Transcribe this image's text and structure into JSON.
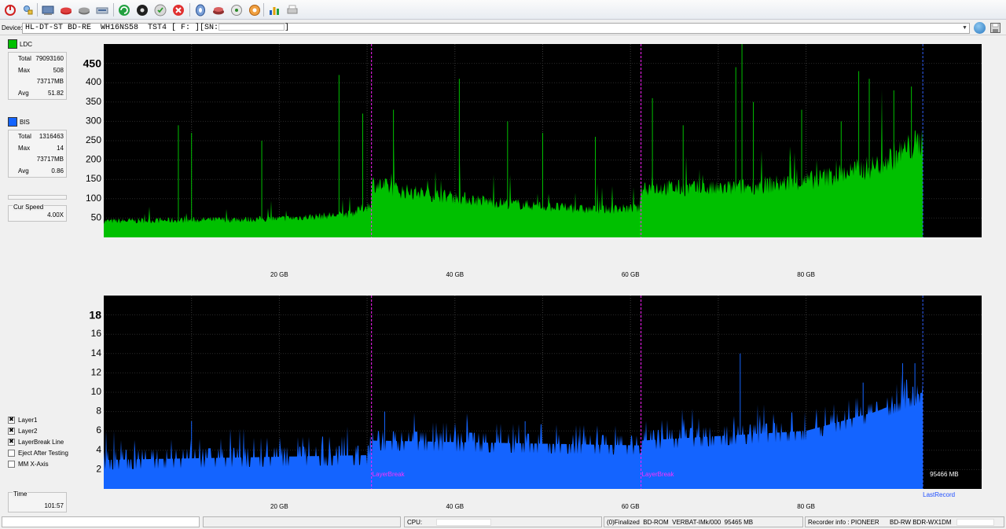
{
  "toolbar": {
    "icons": [
      "power-icon",
      "tools-icon",
      "drive-info-icon",
      "disc-red-icon",
      "disc-gray-icon",
      "scan-icon",
      "refresh-icon",
      "cd-drive-icon",
      "burn-icon",
      "stop-icon",
      "disc-blue-icon",
      "eraser-icon",
      "copy-icon",
      "settings-icon",
      "chart-icon",
      "print-icon"
    ]
  },
  "device": {
    "label": "Device:",
    "value": "HL-DT-ST BD-RE  WH16NS58  TST4 [ F: ][SN:",
    "suffix": "]"
  },
  "ldc": {
    "name": "LDC",
    "color": "#00c000",
    "stats": [
      {
        "label": "Total",
        "value": "79093160"
      },
      {
        "label": "Max",
        "value": "508"
      },
      {
        "label": "",
        "value": "73717MB"
      },
      {
        "label": "Avg",
        "value": "51.82"
      }
    ]
  },
  "bis": {
    "name": "BIS",
    "color": "#1464ff",
    "stats": [
      {
        "label": "Total",
        "value": "1316463"
      },
      {
        "label": "Max",
        "value": "14"
      },
      {
        "label": "",
        "value": "73717MB"
      },
      {
        "label": "Avg",
        "value": "0.86"
      }
    ]
  },
  "cur_speed": {
    "label": "Cur Speed",
    "value": "4.00X"
  },
  "options": [
    {
      "label": "Layer1",
      "checked": true
    },
    {
      "label": "Layer2",
      "checked": true
    },
    {
      "label": "LayerBreak Line",
      "checked": true
    },
    {
      "label": "Eject After Testing",
      "checked": false
    },
    {
      "label": "MM X-Axis",
      "checked": false
    }
  ],
  "time": {
    "label": "Time",
    "value": "101:57"
  },
  "status": {
    "cpu_label": "CPU:",
    "disc_info": "(0)Finalized  BD-ROM  VERBAT-IMk/000  95465 MB",
    "recorder_info": "Recorder info : PIONEER      BD-RW BDR-WX1DM"
  },
  "chart_data": [
    {
      "type": "area",
      "series": [
        {
          "name": "LDC",
          "color": "#00c000"
        }
      ],
      "x_ticks": [
        "20 GB",
        "40 GB",
        "60 GB",
        "80 GB"
      ],
      "x_tick_values": [
        20,
        40,
        60,
        80
      ],
      "xlim": [
        0,
        100
      ],
      "y_ticks": [
        50,
        100,
        150,
        200,
        250,
        300,
        350,
        400,
        450
      ],
      "ylim": [
        0,
        500
      ],
      "y_max_label": "450",
      "layer_breaks": [
        30.5,
        61.2
      ],
      "end_gb": 93.3,
      "baseline": {
        "x": [
          0,
          10,
          20,
          28,
          30.4,
          30.6,
          34,
          45,
          55,
          61,
          61.3,
          70,
          80,
          88,
          93.3
        ],
        "y": [
          42,
          45,
          48,
          60,
          85,
          140,
          120,
          90,
          72,
          75,
          130,
          125,
          145,
          185,
          250
        ]
      },
      "spikes": [
        {
          "x": 8.5,
          "y": 290
        },
        {
          "x": 10,
          "y": 270
        },
        {
          "x": 18,
          "y": 250
        },
        {
          "x": 26.8,
          "y": 420
        },
        {
          "x": 29.5,
          "y": 320
        },
        {
          "x": 33,
          "y": 330
        },
        {
          "x": 40.5,
          "y": 410
        },
        {
          "x": 46,
          "y": 300
        },
        {
          "x": 50,
          "y": 270
        },
        {
          "x": 56,
          "y": 260
        },
        {
          "x": 62.5,
          "y": 360
        },
        {
          "x": 66,
          "y": 290
        },
        {
          "x": 72,
          "y": 440
        },
        {
          "x": 72.7,
          "y": 500
        },
        {
          "x": 74,
          "y": 350
        },
        {
          "x": 79.5,
          "y": 330
        },
        {
          "x": 84,
          "y": 300
        },
        {
          "x": 86,
          "y": 430
        },
        {
          "x": 87.2,
          "y": 410
        },
        {
          "x": 90,
          "y": 380
        },
        {
          "x": 92,
          "y": 390
        }
      ]
    },
    {
      "type": "bar",
      "series": [
        {
          "name": "BIS",
          "color": "#1464ff"
        }
      ],
      "x_ticks": [
        "20 GB",
        "40 GB",
        "60 GB",
        "80 GB"
      ],
      "x_tick_values": [
        20,
        40,
        60,
        80
      ],
      "xlim": [
        0,
        100
      ],
      "y_ticks": [
        2,
        4,
        6,
        8,
        10,
        12,
        14,
        16,
        18
      ],
      "ylim": [
        0,
        20
      ],
      "y_max_label": "18",
      "layer_breaks": [
        30.5,
        61.2
      ],
      "layer_break_label": "LayerBreak",
      "end_gb": 93.3,
      "end_label": "95466 MB",
      "last_record_label": "LastRecord",
      "baseline": {
        "x": [
          0,
          30.4,
          30.6,
          61,
          61.3,
          80,
          88,
          93.3
        ],
        "y": [
          3,
          3.5,
          5,
          4.5,
          5,
          6,
          8,
          10
        ]
      },
      "spikes": [
        {
          "x": 10,
          "y": 7
        },
        {
          "x": 32,
          "y": 8
        },
        {
          "x": 48,
          "y": 7
        },
        {
          "x": 72.5,
          "y": 14
        },
        {
          "x": 86.5,
          "y": 11
        },
        {
          "x": 91,
          "y": 13
        },
        {
          "x": 92.4,
          "y": 13
        }
      ]
    }
  ]
}
